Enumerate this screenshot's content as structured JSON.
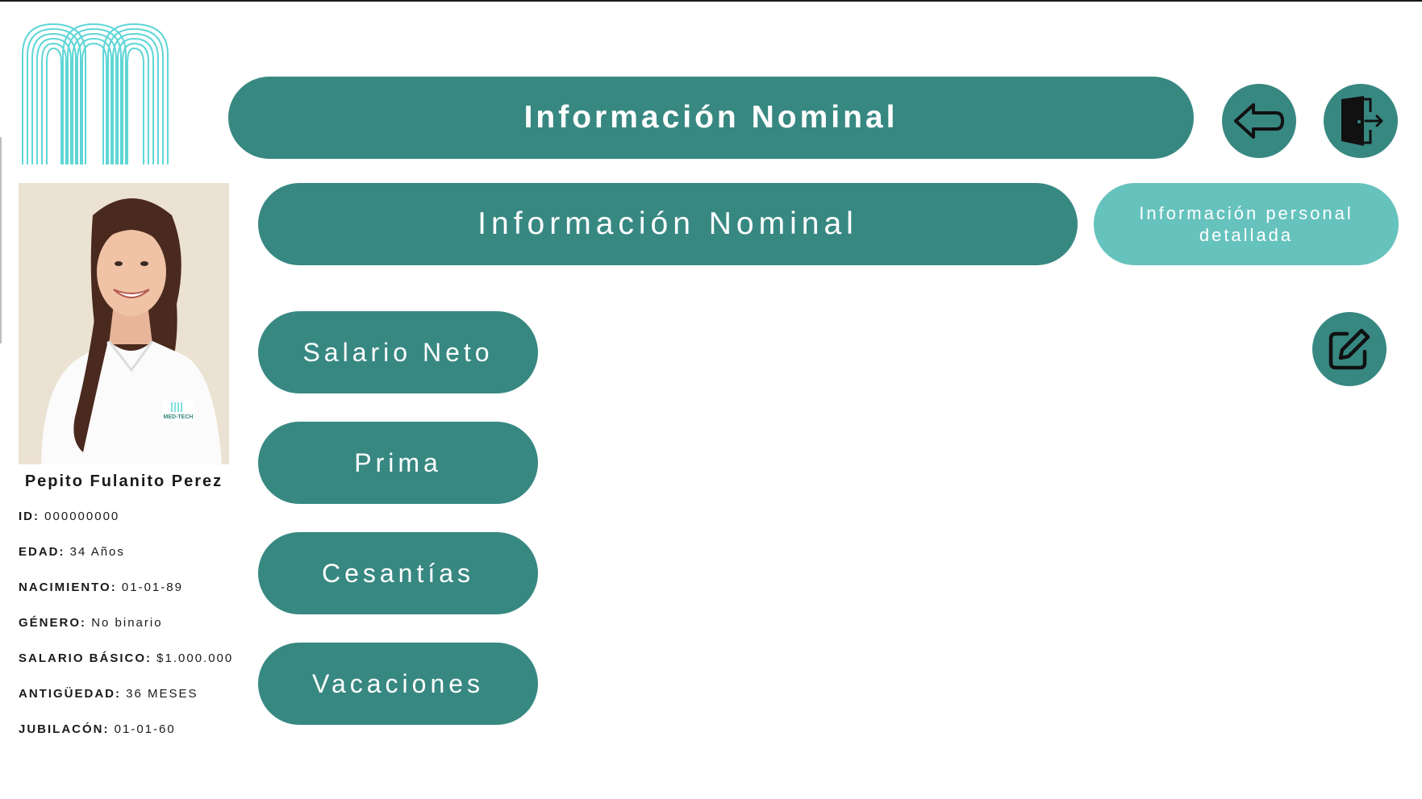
{
  "header": {
    "title": "Información Nominal"
  },
  "section": {
    "title": "Información Nominal",
    "personal_tab_label": "Información personal detallada"
  },
  "options": [
    {
      "label": "Salario Neto"
    },
    {
      "label": "Prima"
    },
    {
      "label": "Cesantías"
    },
    {
      "label": "Vacaciones"
    }
  ],
  "profile": {
    "name": "Pepito Fulanito Perez",
    "photo_badge_text": "MED-TECH",
    "fields": [
      {
        "key": "ID:",
        "value": "000000000"
      },
      {
        "key": "EDAD:",
        "value": "34 Años"
      },
      {
        "key": "NACIMIENTO:",
        "value": "01-01-89"
      },
      {
        "key": "GÉNERO:",
        "value": "No binario"
      },
      {
        "key": "SALARIO BÁSICO:",
        "value": "$1.000.000"
      },
      {
        "key": "ANTIGÜEDAD:",
        "value": "36 MESES"
      },
      {
        "key": "JUBILACÓN:",
        "value": "01-01-60"
      }
    ]
  },
  "icons": {
    "logo": "medtech-logo-icon",
    "back": "arrow-left-icon",
    "exit": "door-exit-icon",
    "edit": "edit-pencil-icon"
  },
  "colors": {
    "primary": "#388882",
    "secondary": "#66c2bd",
    "logo": "#5fd6d6"
  }
}
